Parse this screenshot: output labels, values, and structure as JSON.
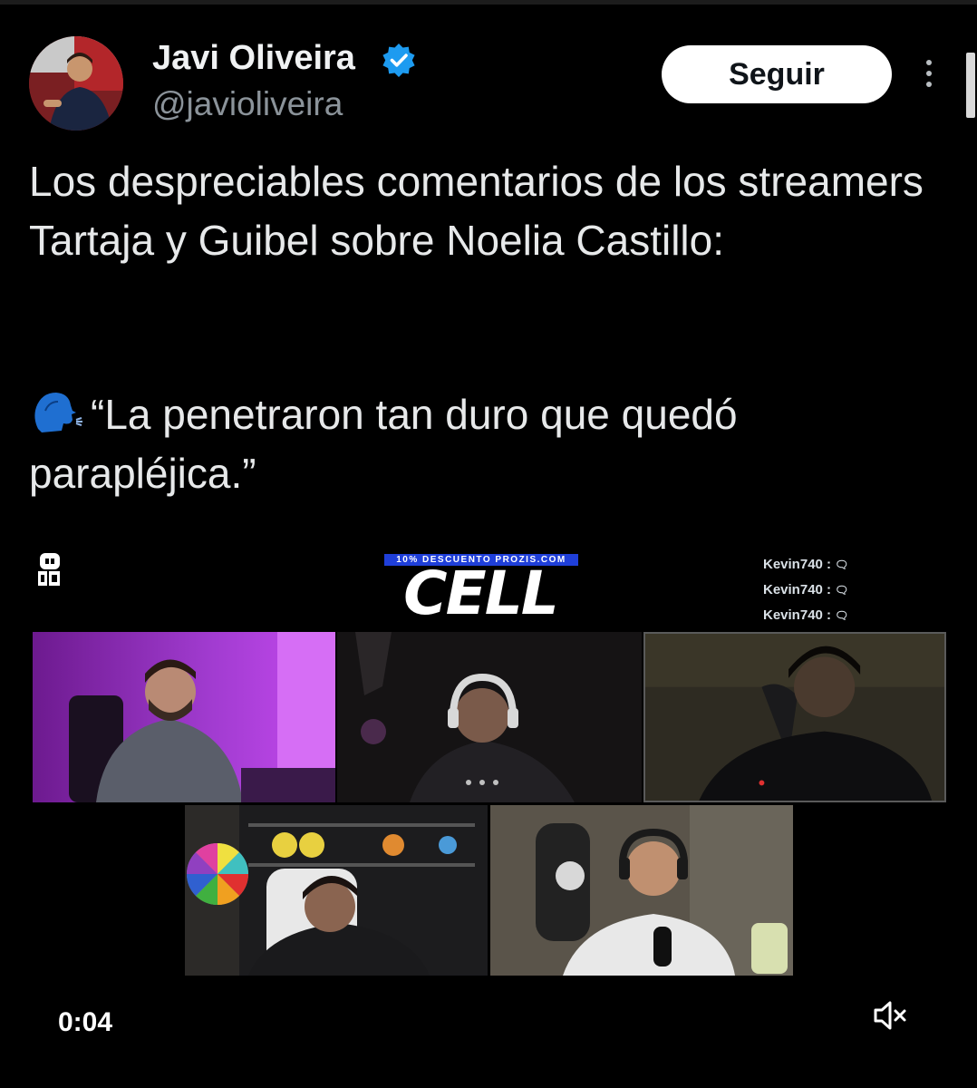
{
  "author": {
    "name": "Javi Oliveira",
    "handle": "@javioliveira",
    "verified": true,
    "verified_color": "#1d9bf0",
    "avatar_icon": "avatar-photo"
  },
  "header": {
    "follow_label": "Seguir",
    "more_icon": "more-vertical-icon"
  },
  "tweet": {
    "text_paragraph": "Los despreciables comentarios de los streamers Tartaja y Guibel sobre Noelia Castillo:",
    "quote_emoji": "speaking-head-icon",
    "quote_text": "“La penetraron tan duro que quedó parapléjica.”"
  },
  "video": {
    "sponsor_text": "10% DESCUENTO PROZIS.COM",
    "title_logo": "CELL",
    "chat": [
      {
        "user": "Kevin740 :",
        "icon": "speech-bubble"
      },
      {
        "user": "Kevin740 :",
        "icon": "speech-bubble"
      },
      {
        "user": "Kevin740 :",
        "icon": "speech-bubble"
      }
    ],
    "elapsed_time": "0:04",
    "muted": true,
    "mute_icon": "speaker-muted-icon"
  },
  "colors": {
    "background": "#000000",
    "text": "#e7e9ea",
    "handle_text": "#8b939a",
    "follow_button_bg": "#ffffff"
  }
}
